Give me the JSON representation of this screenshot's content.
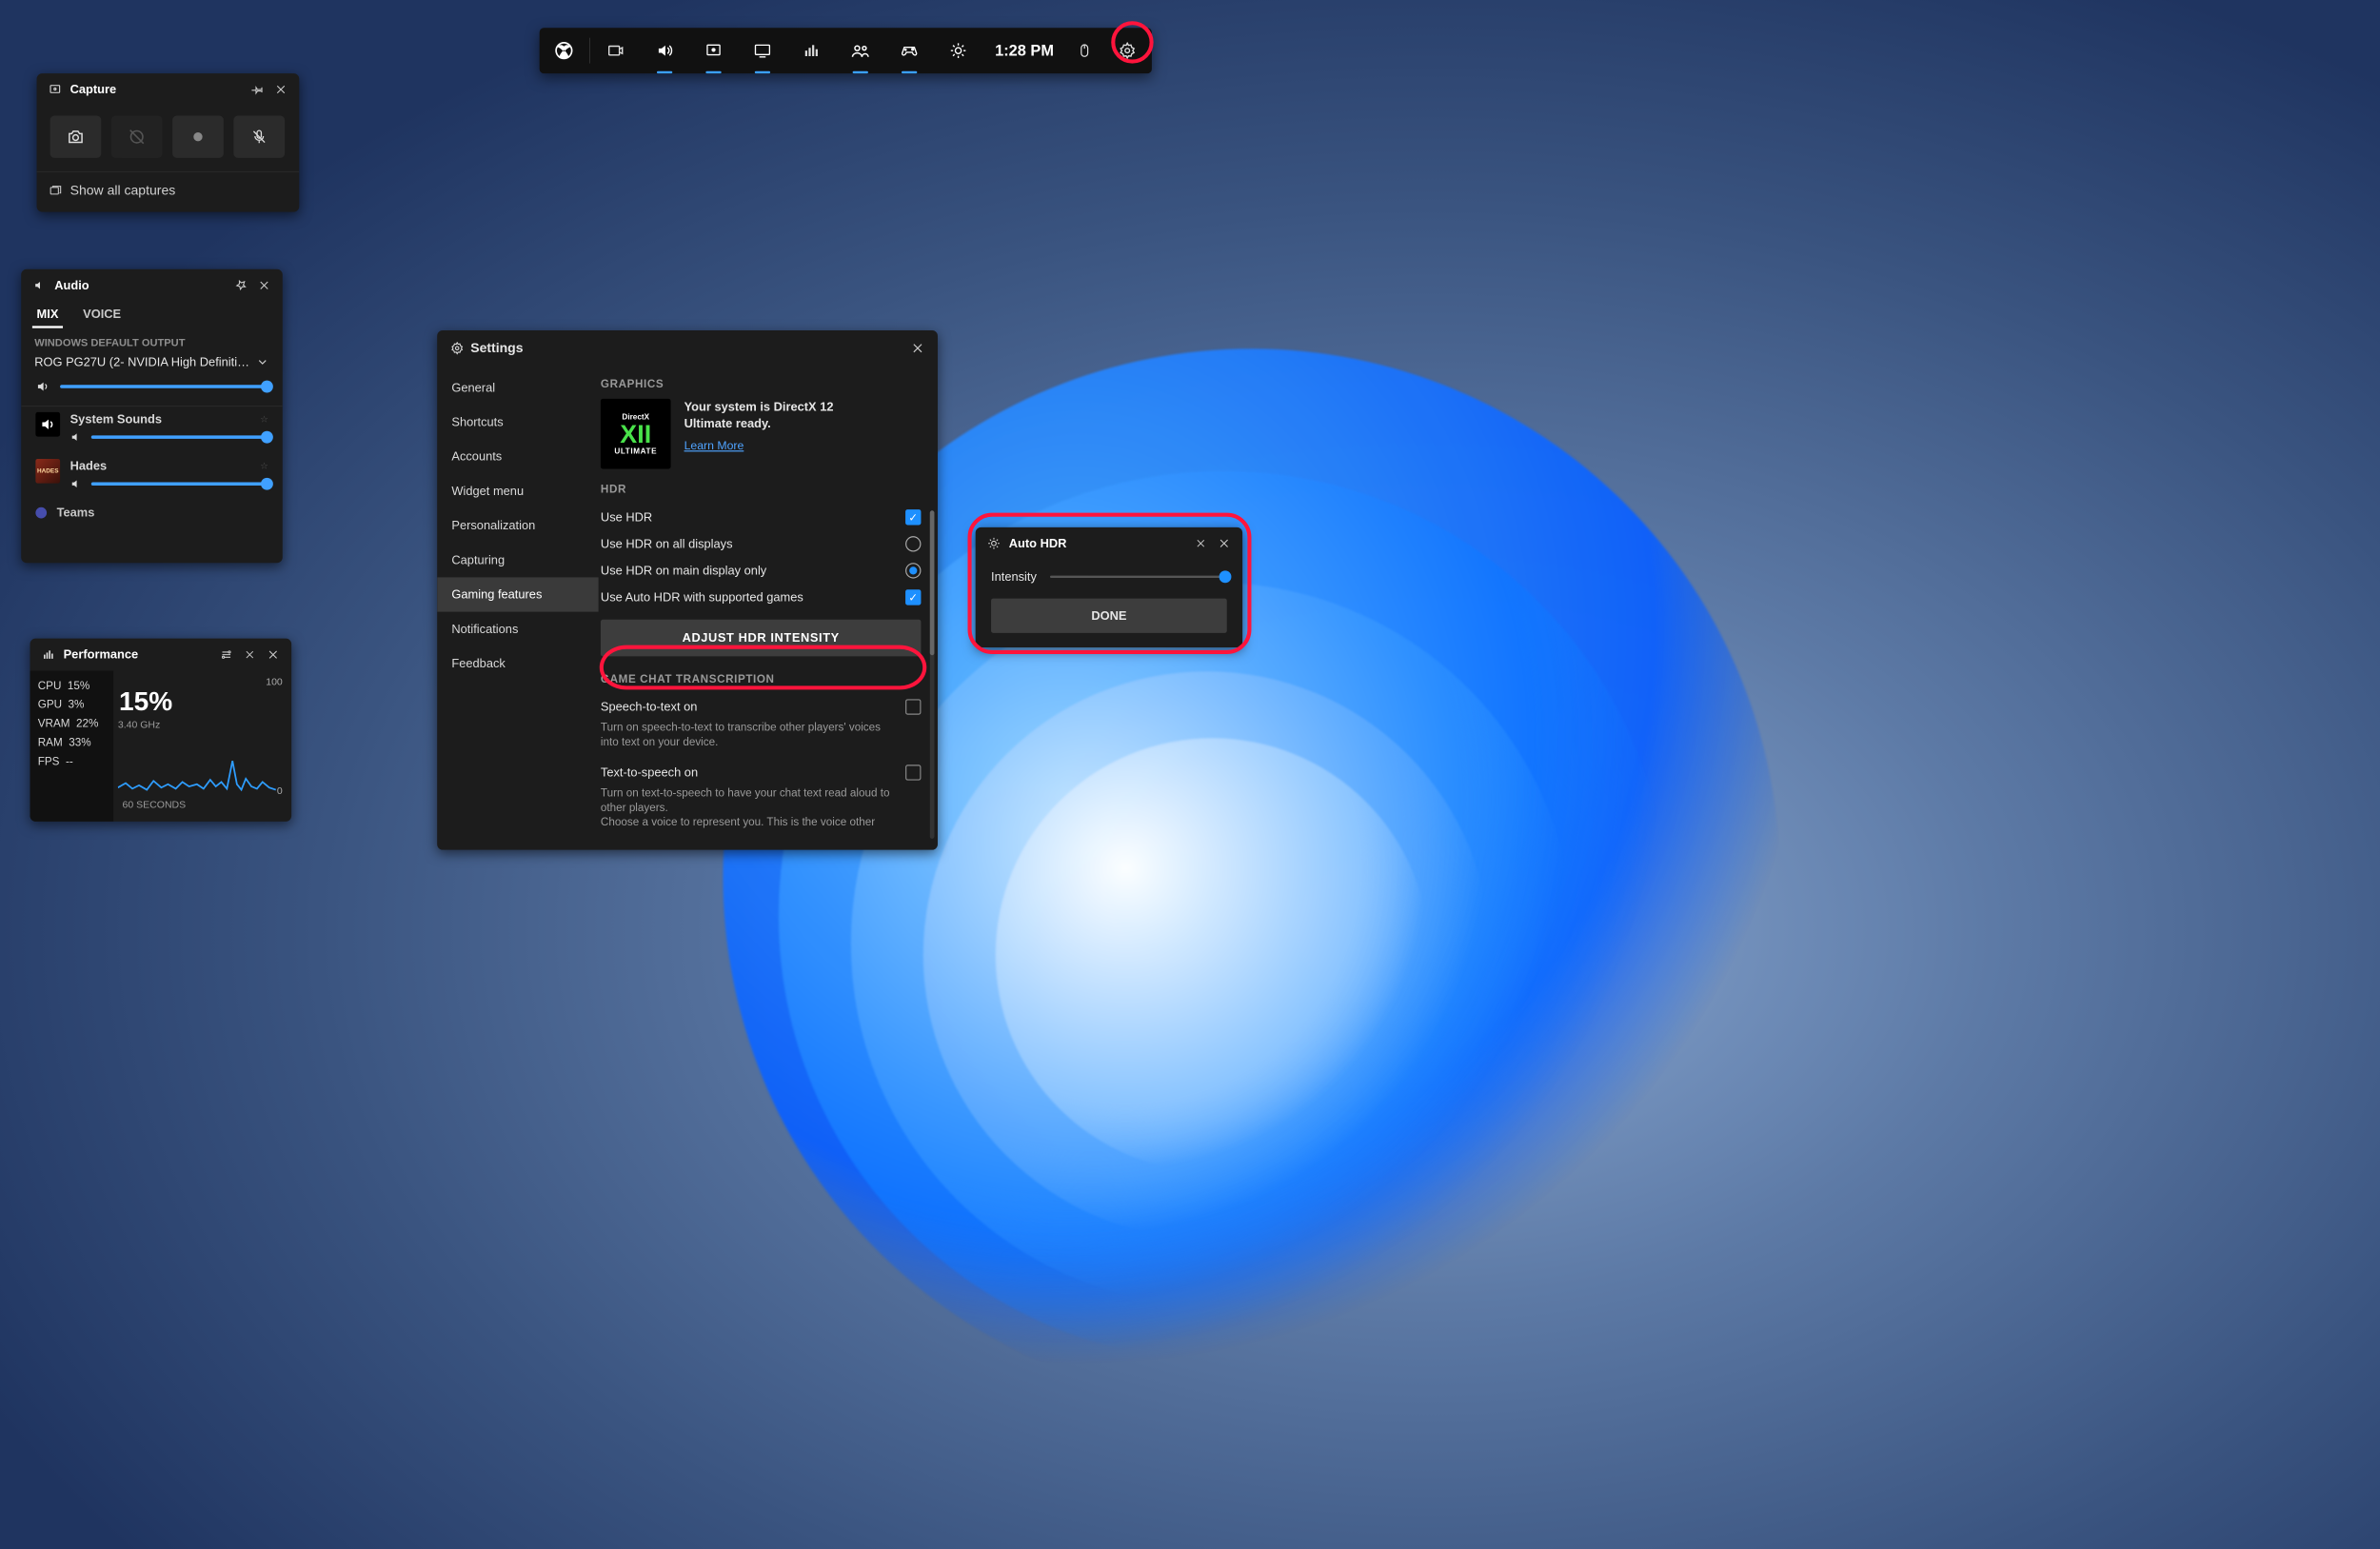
{
  "topbar": {
    "clock": "1:28 PM",
    "icons": [
      "xbox",
      "broadcast",
      "audio",
      "capture",
      "display",
      "performance",
      "social",
      "controller",
      "brightness",
      "clock",
      "mouse",
      "settings"
    ]
  },
  "capture": {
    "title": "Capture",
    "footer": "Show all captures"
  },
  "audio": {
    "title": "Audio",
    "tab_mix": "MIX",
    "tab_voice": "VOICE",
    "default_label": "WINDOWS DEFAULT OUTPUT",
    "device": "ROG PG27U (2- NVIDIA High Definition A...",
    "app1": "System Sounds",
    "app2": "Hades",
    "app3": "Teams"
  },
  "performance": {
    "title": "Performance",
    "stats": [
      {
        "k": "CPU",
        "v": "15%"
      },
      {
        "k": "GPU",
        "v": "3%"
      },
      {
        "k": "VRAM",
        "v": "22%"
      },
      {
        "k": "RAM",
        "v": "33%"
      },
      {
        "k": "FPS",
        "v": "--"
      }
    ],
    "big": "15%",
    "freq": "3.40 GHz",
    "ymax": "100",
    "ymin": "0",
    "xlab": "60 SECONDS"
  },
  "settings": {
    "title": "Settings",
    "menu": [
      "General",
      "Shortcuts",
      "Accounts",
      "Widget menu",
      "Personalization",
      "Capturing",
      "Gaming features",
      "Notifications",
      "Feedback"
    ],
    "active_menu": 6,
    "graphics_label": "GRAPHICS",
    "dx_line": "Your system is DirectX 12 Ultimate ready.",
    "dx_learn": "Learn More",
    "dx_logo_top": "DirectX",
    "dx_logo_mid": "XII",
    "dx_logo_bot": "ULTIMATE",
    "hdr_label": "HDR",
    "opt_usehdr": "Use HDR",
    "opt_all": "Use HDR on all displays",
    "opt_main": "Use HDR on main display only",
    "opt_auto": "Use Auto HDR with supported games",
    "btn_adjust": "ADJUST HDR INTENSITY",
    "chat_label": "GAME CHAT TRANSCRIPTION",
    "stt_title": "Speech-to-text on",
    "stt_desc": "Turn on speech-to-text to transcribe other players' voices into text on your device.",
    "tts_title": "Text-to-speech on",
    "tts_desc": "Turn on text-to-speech to have your chat text read aloud to other players.",
    "tts_extra": "Choose a voice to represent you. This is the voice other"
  },
  "hdr": {
    "title": "Auto HDR",
    "label": "Intensity",
    "done": "DONE"
  }
}
